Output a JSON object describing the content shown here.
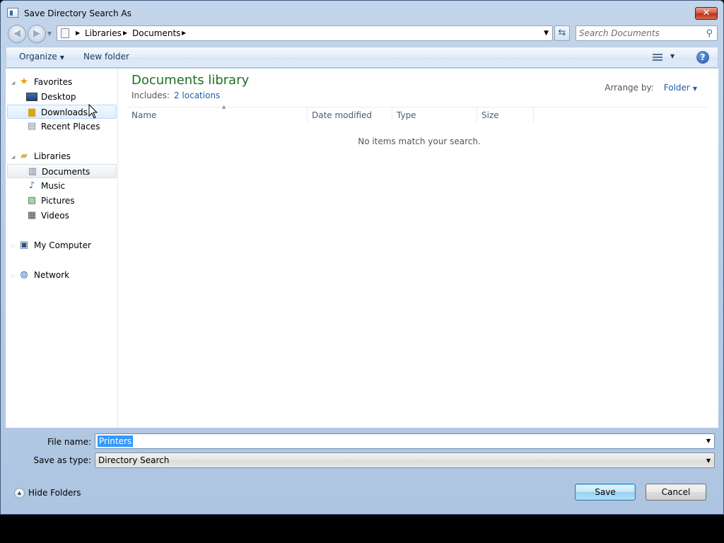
{
  "window": {
    "title": "Save Directory Search As",
    "close_glyph": "✕"
  },
  "nav": {
    "back_glyph": "◀",
    "forward_glyph": "▶",
    "breadcrumb": [
      "Libraries",
      "Documents"
    ],
    "search_placeholder": "Search Documents"
  },
  "toolbar": {
    "organize_label": "Organize",
    "new_folder_label": "New folder",
    "help_glyph": "?"
  },
  "sidebar": {
    "favorites": {
      "label": "Favorites",
      "items": [
        "Desktop",
        "Downloads",
        "Recent Places"
      ]
    },
    "libraries": {
      "label": "Libraries",
      "items": [
        "Documents",
        "Music",
        "Pictures",
        "Videos"
      ]
    },
    "computer_label": "My Computer",
    "network_label": "Network"
  },
  "content": {
    "library_title": "Documents library",
    "includes_label": "Includes:",
    "includes_link": "2 locations",
    "arrange_label": "Arrange by:",
    "arrange_value": "Folder",
    "columns": [
      "Name",
      "Date modified",
      "Type",
      "Size"
    ],
    "empty_message": "No items match your search."
  },
  "form": {
    "file_name_label": "File name:",
    "file_name_value": "Printers",
    "save_type_label": "Save as type:",
    "save_type_value": "Directory Search"
  },
  "footer": {
    "hide_folders_label": "Hide Folders",
    "save_label": "Save",
    "cancel_label": "Cancel"
  }
}
